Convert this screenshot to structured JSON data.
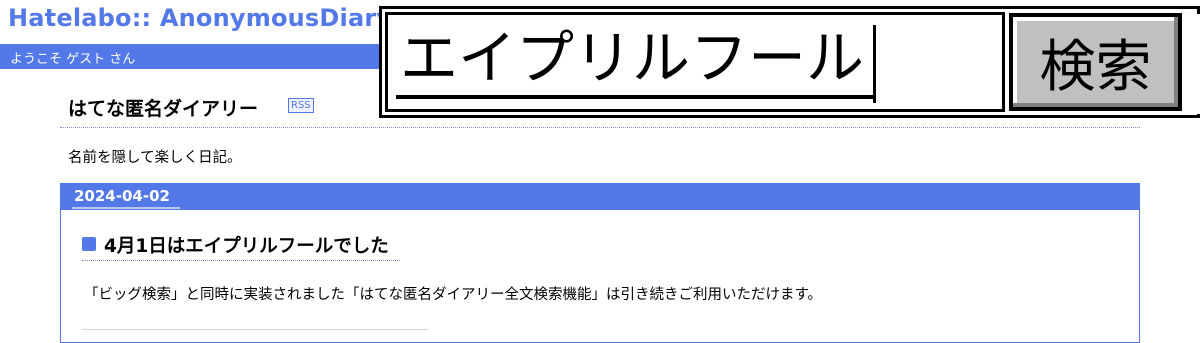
{
  "header": {
    "site_title": "Hatelabo:: AnonymousDiary",
    "welcome": "ようこそ ゲスト さん"
  },
  "diary": {
    "title": "はてな匿名ダイアリー",
    "rss_label": "RSS",
    "tagline": "名前を隠して楽しく日記。"
  },
  "day": {
    "date": "2024-04-02",
    "entry": {
      "title": "4月1日はエイプリルフールでした",
      "body": "「ビッグ検索」と同時に実装されました「はてな匿名ダイアリー全文検索機能」は引き続きご利用いただけます。"
    }
  },
  "search": {
    "query": "エイプリルフール",
    "button_label": "検索"
  },
  "colors": {
    "accent": "#5279e7",
    "button_face": "#c0c0c0"
  }
}
